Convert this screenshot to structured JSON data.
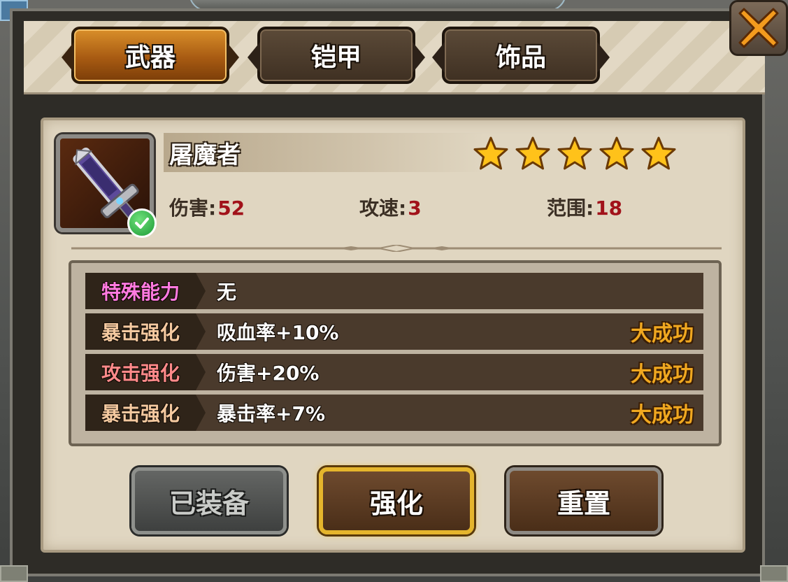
{
  "tabs": [
    {
      "label": "武器",
      "active": true
    },
    {
      "label": "铠甲",
      "active": false
    },
    {
      "label": "饰品",
      "active": false
    }
  ],
  "item": {
    "name": "屠魔者",
    "stars": 5,
    "equipped": true,
    "stats": [
      {
        "label": "伤害:",
        "value": "52"
      },
      {
        "label": "攻速:",
        "value": "3"
      },
      {
        "label": "范围:",
        "value": "18"
      }
    ]
  },
  "attributes": [
    {
      "label": "特殊能力",
      "value": "无",
      "result": "",
      "label_color": "#ff7ae0"
    },
    {
      "label": "暴击强化",
      "value": "吸血率+10%",
      "result": "大成功",
      "label_color": "#f4c9a0"
    },
    {
      "label": "攻击强化",
      "value": "伤害+20%",
      "result": "大成功",
      "label_color": "#ff8a8a"
    },
    {
      "label": "暴击强化",
      "value": "暴击率+7%",
      "result": "大成功",
      "label_color": "#f4c9a0"
    }
  ],
  "buttons": {
    "equipped": "已装备",
    "enhance": "强化",
    "reset": "重置"
  },
  "icons": {
    "close": "close-x-icon",
    "star": "star-icon",
    "equipped_badge": "check-icon",
    "item": "sword-icon"
  },
  "colors": {
    "active_tab": "#c0701c",
    "stat_value": "#a1121a",
    "result": "#f0a820",
    "enhance_border": "#e5b52c"
  }
}
